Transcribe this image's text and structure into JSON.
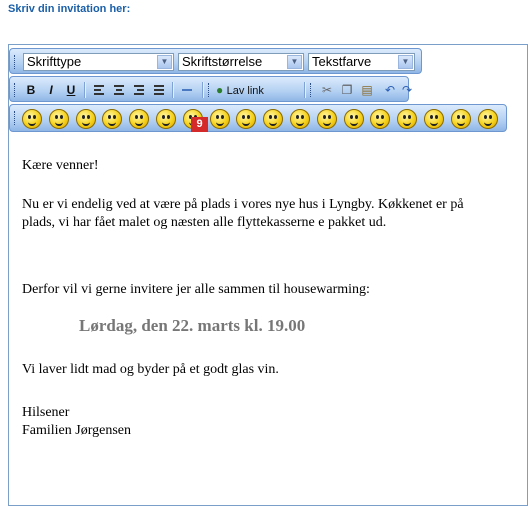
{
  "page": {
    "heading": "Skriv din invitation her:"
  },
  "toolbar": {
    "font_type": "Skrifttype",
    "font_size": "Skriftstørrelse",
    "text_color": "Tekstfarve",
    "bold": "B",
    "italic": "I",
    "underline": "U",
    "link_label": "Lav link"
  },
  "smileys": [
    "smile",
    "grin",
    "wink",
    "surprised",
    "shocked",
    "tongue",
    "cool",
    "laugh",
    "happy",
    "blush",
    "worried",
    "neutral",
    "sad",
    "cry",
    "frown",
    "angry",
    "sick",
    "big-grin"
  ],
  "content": {
    "greeting": "Kære venner!",
    "paragraph1": "Nu er vi endelig ved at være på plads i vores nye hus i Lyngby. Køkkenet er på plads, vi har fået malet og næsten alle flyttekasserne e pakket ud.",
    "paragraph2": "Derfor vil vi gerne invitere jer alle sammen til housewarming:",
    "date_line": "Lørdag, den 22. marts kl. 19.00",
    "paragraph3": "Vi laver lidt mad og byder på et godt glas vin.",
    "closing1": "Hilsener",
    "closing2": "Familien Jørgensen"
  },
  "annotation_badge": "9"
}
